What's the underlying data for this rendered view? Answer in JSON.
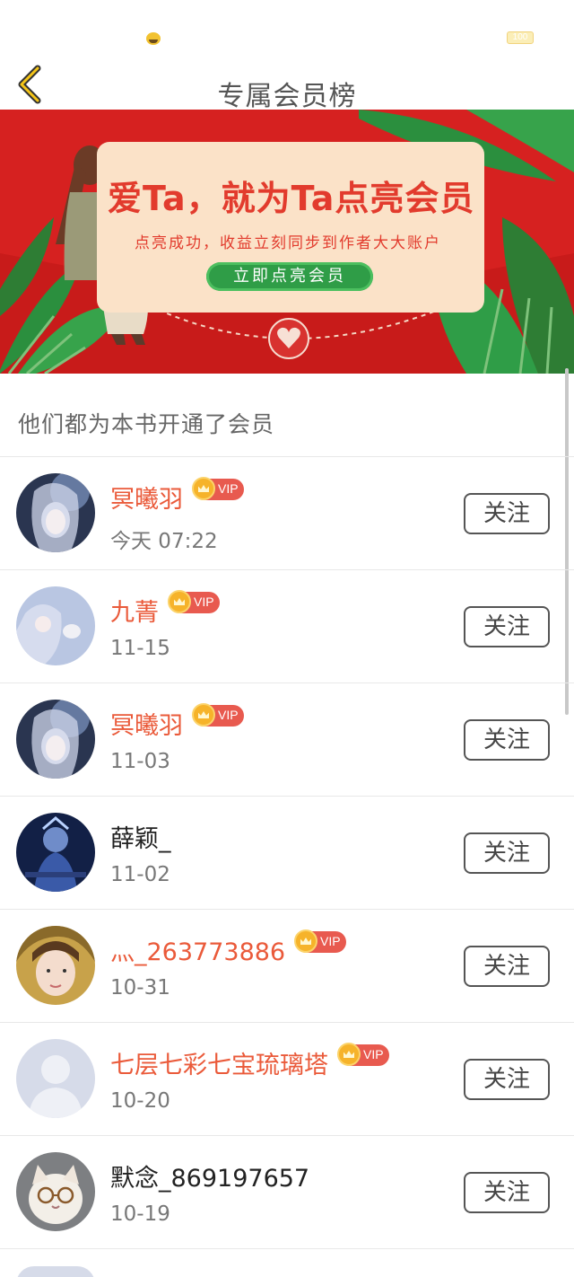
{
  "status_bar": {
    "battery": "100"
  },
  "header": {
    "title": "专属会员榜"
  },
  "banner": {
    "headline": "爱Ta，就为Ta点亮会员",
    "subtitle": "点亮成功，收益立刻同步到作者大大账户",
    "cta": "立即点亮会员"
  },
  "section": {
    "title": "他们都为本书开通了会员"
  },
  "members": [
    {
      "name": "冥曦羽",
      "time": "今天 07:22",
      "vip": true,
      "vip_label": "VIP",
      "follow": "关注",
      "avatar": "avatar-fantasy-silver"
    },
    {
      "name": "九菁",
      "time": "11-15",
      "vip": true,
      "vip_label": "VIP",
      "follow": "关注",
      "avatar": "avatar-fantasy-girl"
    },
    {
      "name": "冥曦羽",
      "time": "11-03",
      "vip": true,
      "vip_label": "VIP",
      "follow": "关注",
      "avatar": "avatar-fantasy-silver"
    },
    {
      "name": "薛颖_",
      "time": "11-02",
      "vip": false,
      "vip_label": "",
      "follow": "关注",
      "avatar": "avatar-game-warrior"
    },
    {
      "name": "灬_263773886",
      "time": "10-31",
      "vip": true,
      "vip_label": "VIP",
      "follow": "关注",
      "avatar": "avatar-photo-girl"
    },
    {
      "name": "七层七彩七宝琉璃塔",
      "time": "10-20",
      "vip": true,
      "vip_label": "VIP",
      "follow": "关注",
      "avatar": "avatar-default"
    },
    {
      "name": "默念_869197657",
      "time": "10-19",
      "vip": false,
      "vip_label": "",
      "follow": "关注",
      "avatar": "avatar-cat"
    }
  ],
  "colors": {
    "vip_name": "#ea5a3a",
    "banner_red": "#d62120",
    "cta_green": "#2f9d47"
  }
}
